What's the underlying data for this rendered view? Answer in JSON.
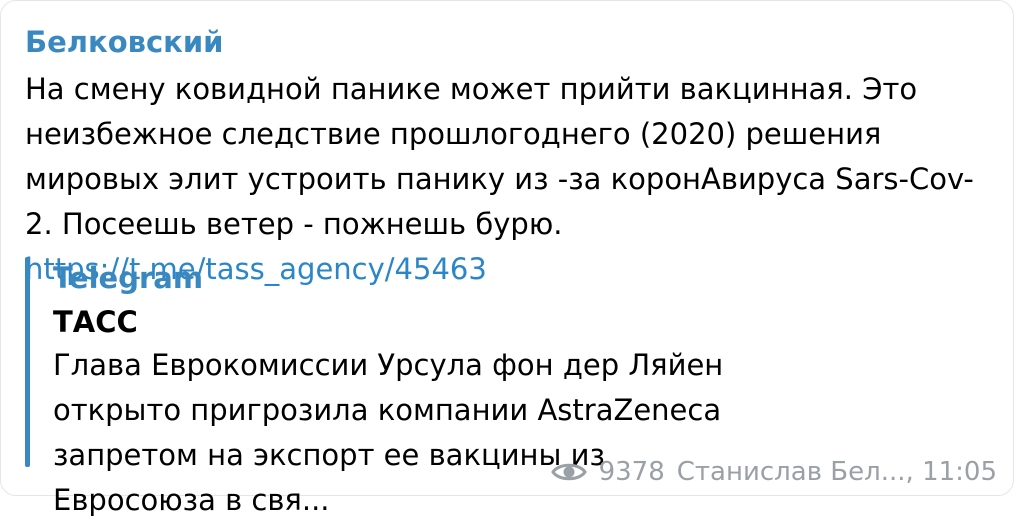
{
  "message": {
    "channel_name": "Белковский",
    "text": "На смену ковидной панике может прийти вакцинная. Это неизбежное следствие прошлогоднего (2020) решения мировых элит устроить панику из -за коронАвируса Sars-Cov-2. Посеешь ветер - пожнешь бурю. ",
    "link": "https://t.me/tass_agency/45463"
  },
  "preview": {
    "site_name": "Telegram",
    "title": "ТАСС",
    "description": "Глава Еврокомиссии Урсула фон дер Ляйен открыто пригрозила компании AstraZeneca запретом на экспорт ее вакцины из Евросоюза в свя..."
  },
  "meta": {
    "views_icon": "eye-icon",
    "views": "9378",
    "author_time": "Станислав Бел..., 11:05"
  },
  "colors": {
    "accent": "#3a88c0",
    "link": "#2a86c8",
    "meta": "#9aa0a6"
  }
}
